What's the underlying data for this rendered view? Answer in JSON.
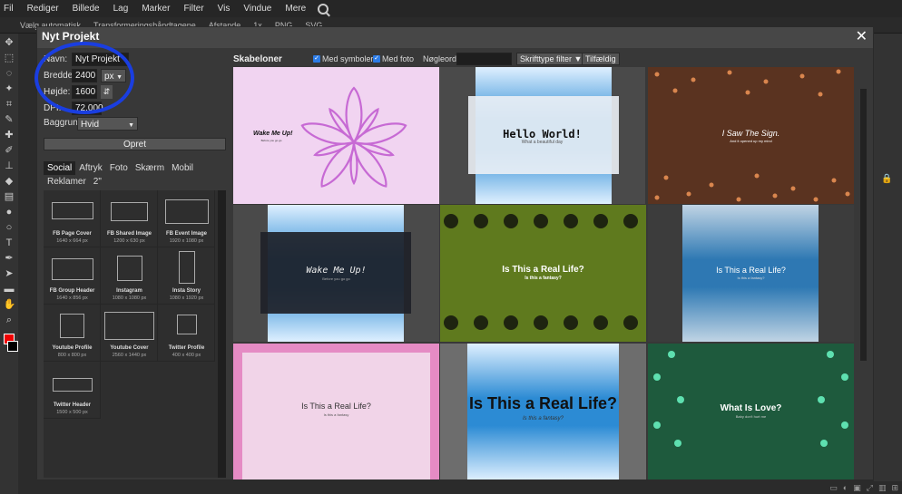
{
  "menu": [
    "Fil",
    "Rediger",
    "Billede",
    "Lag",
    "Marker",
    "Filter",
    "Vis",
    "Vindue",
    "Mere"
  ],
  "options_bar": [
    "Vælg automatisk",
    "Transformeringshåndtagene",
    "Afstande",
    "1x",
    "PNG",
    "SVG"
  ],
  "dialog": {
    "title": "Nyt Projekt",
    "close": "✕",
    "name_label": "Navn:",
    "name_value": "Nyt Projekt",
    "width_label": "Bredde:",
    "width_value": "2400",
    "unit_value": "px",
    "height_label": "Højde:",
    "height_value": "1600",
    "swap": "⇵",
    "dpi_label": "DPI:",
    "dpi_value": "72.000",
    "bg_label": "Baggrund:",
    "bg_value": "Hvid",
    "create_label": "Opret"
  },
  "categories": [
    {
      "label": "Social",
      "active": true
    },
    {
      "label": "Aftryk",
      "active": false
    },
    {
      "label": "Foto",
      "active": false
    },
    {
      "label": "Skærm",
      "active": false
    },
    {
      "label": "Mobil",
      "active": false
    },
    {
      "label": "Reklamer",
      "active": false
    },
    {
      "label": "2\"",
      "active": false
    }
  ],
  "presets": [
    {
      "name": "FB Page Cover",
      "size": "1640 x 664 px"
    },
    {
      "name": "FB Shared Image",
      "size": "1200 x 630 px"
    },
    {
      "name": "FB Event Image",
      "size": "1920 x 1080 px"
    },
    {
      "name": "FB Group Header",
      "size": "1640 x 856 px"
    },
    {
      "name": "Instagram",
      "size": "1080 x 1080 px"
    },
    {
      "name": "Insta Story",
      "size": "1080 x 1920 px"
    },
    {
      "name": "Youtube Profile",
      "size": "800 x 800 px"
    },
    {
      "name": "Youtube Cover",
      "size": "2560 x 1440 px"
    },
    {
      "name": "Twitter Profile",
      "size": "400 x 400 px"
    },
    {
      "name": "Twitter Header",
      "size": "1500 x 500 px"
    }
  ],
  "templates_header": {
    "title": "Skabeloner",
    "with_symbols": "Med symboler",
    "with_photo": "Med foto",
    "keyword_label": "Nøgleord:",
    "font_filter": "Skrifttype filter ▼",
    "random": "Tilfældig"
  },
  "templates": [
    {
      "title": "Wake Me Up!",
      "subtitle": "Before you go go",
      "bg": "#f1d4f1"
    },
    {
      "title": "Hello World!",
      "subtitle": "What a beautiful day",
      "bg": "#4a4a4a"
    },
    {
      "title": "I Saw The Sign.",
      "subtitle": "And it opened up my mind",
      "bg": "#5a3320"
    },
    {
      "title": "Wake Me Up!",
      "subtitle": "Before you go go",
      "bg": "#4a4a4a"
    },
    {
      "title": "Is This a Real Life?",
      "subtitle": "Is this a fantasy?",
      "bg": "#5f7a1e"
    },
    {
      "title": "Is This a Real Life?",
      "subtitle": "Is this a fantasy?",
      "bg": "#3c3c3c"
    },
    {
      "title": "Is This a Real Life?",
      "subtitle": "Is this a fantasy",
      "bg": "#e58bc4"
    },
    {
      "title": "Is This a Real Life?",
      "subtitle": "Is this a fantasy?",
      "bg": "#6d6d6d"
    },
    {
      "title": "What Is Love?",
      "subtitle": "Baby don't hurt me",
      "bg": "#1e5a3d"
    }
  ]
}
